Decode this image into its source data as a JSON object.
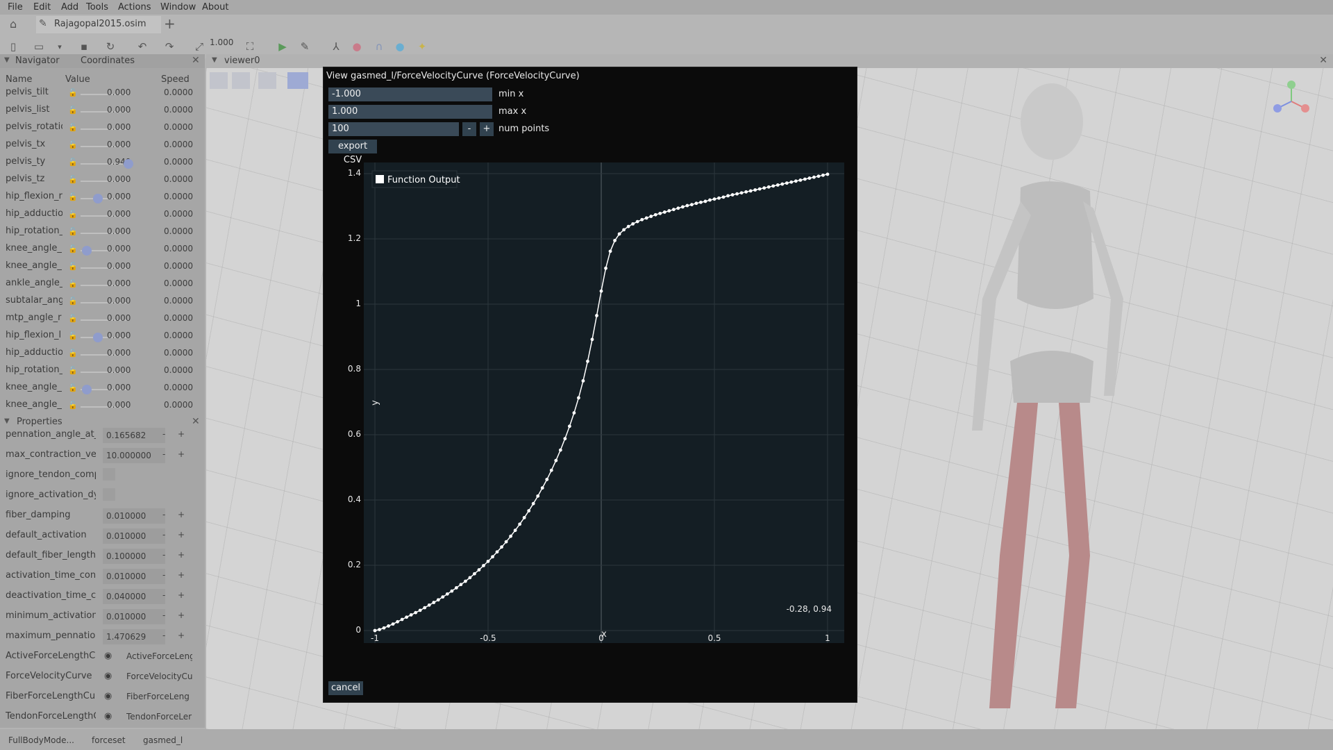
{
  "menu": [
    "File",
    "Edit",
    "Add",
    "Tools",
    "Actions",
    "Window",
    "About"
  ],
  "tab": {
    "title": "Rajagopal2015.osim",
    "add_label": "+"
  },
  "toolbar": {
    "scale_value": "1.000"
  },
  "navigator": {
    "title": "Navigator",
    "coordinates_tab": "Coordinates",
    "columns": {
      "name": "Name",
      "value": "Value",
      "speed": "Speed"
    },
    "rows": [
      {
        "name": "pelvis_tilt",
        "value": "0.000",
        "speed": "0.0000"
      },
      {
        "name": "pelvis_list",
        "value": "0.000",
        "speed": "0.0000"
      },
      {
        "name": "pelvis_rotatio",
        "value": "0.000",
        "speed": "0.0000"
      },
      {
        "name": "pelvis_tx",
        "value": "0.000",
        "speed": "0.0000"
      },
      {
        "name": "pelvis_ty",
        "value": "0.940",
        "speed": "0.0000"
      },
      {
        "name": "pelvis_tz",
        "value": "0.000",
        "speed": "0.0000"
      },
      {
        "name": "hip_flexion_r",
        "value": "0.000",
        "speed": "0.0000"
      },
      {
        "name": "hip_adductior",
        "value": "0.000",
        "speed": "0.0000"
      },
      {
        "name": "hip_rotation_i",
        "value": "0.000",
        "speed": "0.0000"
      },
      {
        "name": "knee_angle_r",
        "value": "0.000",
        "speed": "0.0000"
      },
      {
        "name": "knee_angle_r",
        "value": "0.000",
        "speed": "0.0000"
      },
      {
        "name": "ankle_angle_i",
        "value": "0.000",
        "speed": "0.0000"
      },
      {
        "name": "subtalar_angl",
        "value": "0.000",
        "speed": "0.0000"
      },
      {
        "name": "mtp_angle_r",
        "value": "0.000",
        "speed": "0.0000"
      },
      {
        "name": "hip_flexion_l",
        "value": "0.000",
        "speed": "0.0000"
      },
      {
        "name": "hip_adductior",
        "value": "0.000",
        "speed": "0.0000"
      },
      {
        "name": "hip_rotation_l",
        "value": "0.000",
        "speed": "0.0000"
      },
      {
        "name": "knee_angle_l",
        "value": "0.000",
        "speed": "0.0000"
      },
      {
        "name": "knee_angle_l",
        "value": "0.000",
        "speed": "0.0000"
      }
    ]
  },
  "properties": {
    "title": "Properties",
    "numeric": [
      {
        "name": "pennation_angle_at_i",
        "value": "0.165682"
      },
      {
        "name": "max_contraction_velo",
        "value": "10.000000"
      }
    ],
    "checks": [
      "ignore_tendon_compl",
      "ignore_activation_dyr"
    ],
    "numeric2": [
      {
        "name": "fiber_damping",
        "value": "0.010000"
      },
      {
        "name": "default_activation",
        "value": "0.010000"
      },
      {
        "name": "default_fiber_length",
        "value": "0.100000"
      },
      {
        "name": "activation_time_cons",
        "value": "0.010000"
      },
      {
        "name": "deactivation_time_co",
        "value": "0.040000"
      },
      {
        "name": "minimum_activation",
        "value": "0.010000"
      },
      {
        "name": "maximum_pennation",
        "value": "1.470629"
      }
    ],
    "curves": [
      {
        "name": "ActiveForceLengthCur",
        "value": "ActiveForceLeng"
      },
      {
        "name": "ForceVelocityCurve",
        "value": "ForceVelocityCu"
      },
      {
        "name": "FiberForceLengthCurv",
        "value": "FiberForceLeng"
      },
      {
        "name": "TendonForceLengthCu",
        "value": "TendonForceLer"
      }
    ],
    "minus": "-",
    "plus": "+"
  },
  "viewer": {
    "title": "viewer0"
  },
  "statusbar": {
    "crumbs": [
      "FullBodyMode...",
      "forceset",
      "gasmed_l"
    ]
  },
  "dialog": {
    "title": "View gasmed_l/ForceVelocityCurve (ForceVelocityCurve)",
    "min_x": "-1.000",
    "min_x_label": "min x",
    "max_x": "1.000",
    "max_x_label": "max x",
    "num_points": "100",
    "num_points_label": "num points",
    "minus": "-",
    "plus": "+",
    "export_label": "export CSV",
    "cancel_label": "cancel",
    "hover_readout": "-0.28, 0.94"
  },
  "chart_data": {
    "type": "line",
    "title": "",
    "xlabel": "x",
    "ylabel": "y",
    "xlim": [
      -1,
      1
    ],
    "ylim": [
      0,
      1.4
    ],
    "xticks": [
      "-1",
      "-0.5",
      "0",
      "0.5",
      "1"
    ],
    "yticks": [
      "0",
      "0.2",
      "0.4",
      "0.6",
      "0.8",
      "1",
      "1.2",
      "1.4"
    ],
    "legend": "top-left",
    "grid": true,
    "series": [
      {
        "name": "Function Output",
        "x": [
          -1.0,
          -0.98,
          -0.96,
          -0.94,
          -0.92,
          -0.9,
          -0.88,
          -0.86,
          -0.84,
          -0.82,
          -0.8,
          -0.78,
          -0.76,
          -0.74,
          -0.72,
          -0.7,
          -0.68,
          -0.66,
          -0.64,
          -0.62,
          -0.6,
          -0.58,
          -0.56,
          -0.54,
          -0.52,
          -0.5,
          -0.48,
          -0.46,
          -0.44,
          -0.42,
          -0.4,
          -0.38,
          -0.36,
          -0.34,
          -0.32,
          -0.3,
          -0.28,
          -0.26,
          -0.24,
          -0.22,
          -0.2,
          -0.18,
          -0.16,
          -0.14,
          -0.12,
          -0.1,
          -0.08,
          -0.06,
          -0.04,
          -0.02,
          0.0,
          0.02,
          0.04,
          0.06,
          0.08,
          0.1,
          0.12,
          0.14,
          0.16,
          0.18,
          0.2,
          0.22,
          0.24,
          0.26,
          0.28,
          0.3,
          0.32,
          0.34,
          0.36,
          0.38,
          0.4,
          0.42,
          0.44,
          0.46,
          0.48,
          0.5,
          0.52,
          0.54,
          0.56,
          0.58,
          0.6,
          0.62,
          0.64,
          0.66,
          0.68,
          0.7,
          0.72,
          0.74,
          0.76,
          0.78,
          0.8,
          0.82,
          0.84,
          0.86,
          0.88,
          0.9,
          0.92,
          0.94,
          0.96,
          0.98,
          1.0
        ],
        "y": [
          0.0,
          0.003,
          0.008,
          0.014,
          0.02,
          0.027,
          0.034,
          0.041,
          0.048,
          0.055,
          0.062,
          0.07,
          0.078,
          0.086,
          0.094,
          0.103,
          0.112,
          0.121,
          0.131,
          0.141,
          0.151,
          0.162,
          0.174,
          0.186,
          0.199,
          0.212,
          0.226,
          0.241,
          0.256,
          0.272,
          0.289,
          0.307,
          0.326,
          0.346,
          0.367,
          0.389,
          0.412,
          0.437,
          0.463,
          0.491,
          0.521,
          0.553,
          0.588,
          0.626,
          0.667,
          0.713,
          0.765,
          0.825,
          0.892,
          0.965,
          1.04,
          1.11,
          1.162,
          1.195,
          1.215,
          1.228,
          1.238,
          1.246,
          1.253,
          1.259,
          1.264,
          1.269,
          1.274,
          1.278,
          1.282,
          1.286,
          1.29,
          1.294,
          1.298,
          1.302,
          1.305,
          1.309,
          1.312,
          1.315,
          1.319,
          1.322,
          1.325,
          1.328,
          1.332,
          1.335,
          1.338,
          1.341,
          1.344,
          1.347,
          1.35,
          1.353,
          1.356,
          1.359,
          1.362,
          1.365,
          1.368,
          1.371,
          1.374,
          1.377,
          1.38,
          1.383,
          1.386,
          1.389,
          1.392,
          1.395,
          1.398
        ]
      }
    ]
  }
}
